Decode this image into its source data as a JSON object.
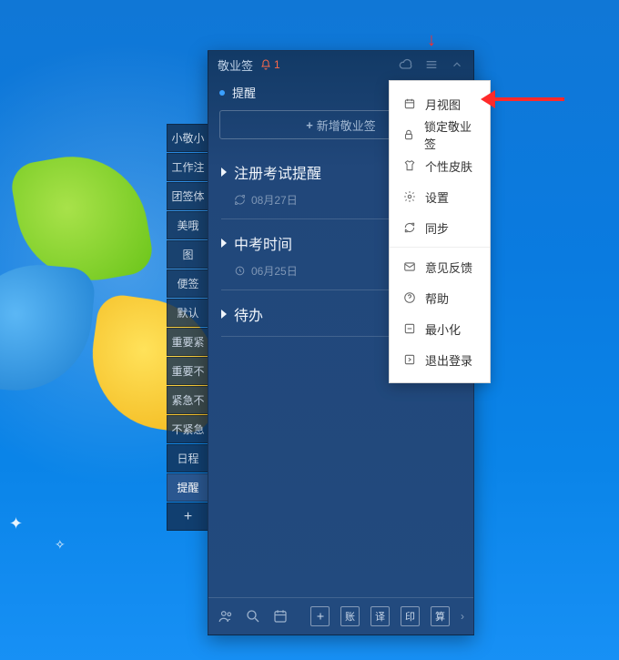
{
  "app": {
    "title": "敬业签",
    "notification_count": "1",
    "section_title": "提醒",
    "add_button": "新增敬业签",
    "items": [
      {
        "title": "注册考试提醒",
        "date": "08月27日",
        "icon": "repeat"
      },
      {
        "title": "中考时间",
        "date": "06月25日",
        "icon": "clock"
      },
      {
        "title": "待办",
        "date": "",
        "icon": ""
      }
    ],
    "bottom_icons": [
      "账",
      "译",
      "印",
      "算"
    ]
  },
  "tabs": [
    "小敬小",
    "工作注",
    "团签体",
    "美哦",
    "图",
    "便签",
    "默认",
    "重要紧",
    "重要不",
    "紧急不",
    "不紧急",
    "日程",
    "提醒"
  ],
  "tab_plus": "+",
  "active_tab_index": 12,
  "menu": [
    {
      "icon": "calendar",
      "label": "月视图"
    },
    {
      "icon": "lock",
      "label": "锁定敬业签"
    },
    {
      "icon": "shirt",
      "label": "个性皮肤"
    },
    {
      "icon": "gear",
      "label": "设置"
    },
    {
      "icon": "sync",
      "label": "同步"
    },
    {
      "sep": true
    },
    {
      "icon": "mail",
      "label": "意见反馈"
    },
    {
      "icon": "help",
      "label": "帮助"
    },
    {
      "icon": "minimize",
      "label": "最小化"
    },
    {
      "icon": "exit",
      "label": "退出登录"
    }
  ]
}
